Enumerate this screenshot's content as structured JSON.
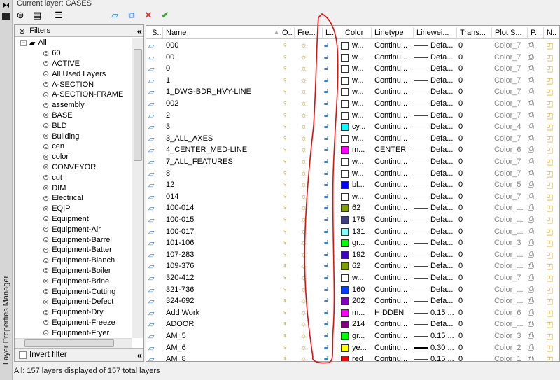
{
  "window": {
    "title": "Current layer: CASES",
    "panel_title": "Layer Properties Manager"
  },
  "toolbar": [
    "new-property-filter",
    "new-group-filter",
    "layer-states-manager",
    "new-layer",
    "new-layer-vp-frozen",
    "delete-layer",
    "set-current"
  ],
  "filters": {
    "title": "Filters",
    "invert_label": "Invert filter",
    "root": "All",
    "items": [
      "60",
      "ACTIVE",
      "All Used Layers",
      "A-SECTION",
      "A-SECTION-FRAME",
      "assembly",
      "BASE",
      "BLD",
      "Building",
      "cen",
      "color",
      "CONVEYOR",
      "cut",
      "DIM",
      "Electrical",
      "EQIP",
      "Equipment",
      "Equipment-Air",
      "Equipment-Barrel",
      "Equipment-Batter",
      "Equipment-Blanch",
      "Equipment-Boiler",
      "Equipment-Brine",
      "Equipment-Cutting",
      "Equipment-Defect",
      "Equipment-Dry",
      "Equipment-Freeze",
      "Equipment-Fryer"
    ]
  },
  "columns": [
    "S..",
    "Name",
    "O..",
    "Fre...",
    "L...",
    "Color",
    "Linetype",
    "Linewei...",
    "Trans...",
    "Plot S...",
    "P...",
    "N.."
  ],
  "layers": [
    {
      "name": "000",
      "color": "w...",
      "hex": "#ffffff",
      "linetype": "Continu...",
      "lineweight": "Defa...",
      "trans": "0",
      "plot": "Color_7"
    },
    {
      "name": "00",
      "color": "w...",
      "hex": "#ffffff",
      "linetype": "Continu...",
      "lineweight": "Defa...",
      "trans": "0",
      "plot": "Color_7"
    },
    {
      "name": "0",
      "color": "w...",
      "hex": "#ffffff",
      "linetype": "Continu...",
      "lineweight": "Defa...",
      "trans": "0",
      "plot": "Color_7"
    },
    {
      "name": "1",
      "color": "w...",
      "hex": "#ffffff",
      "linetype": "Continu...",
      "lineweight": "Defa...",
      "trans": "0",
      "plot": "Color_7"
    },
    {
      "name": "1_DWG-BDR_HVY-LINE",
      "color": "w...",
      "hex": "#ffffff",
      "linetype": "Continu...",
      "lineweight": "Defa...",
      "trans": "0",
      "plot": "Color_7"
    },
    {
      "name": "002",
      "color": "w...",
      "hex": "#ffffff",
      "linetype": "Continu...",
      "lineweight": "Defa...",
      "trans": "0",
      "plot": "Color_7"
    },
    {
      "name": "2",
      "color": "w...",
      "hex": "#ffffff",
      "linetype": "Continu...",
      "lineweight": "Defa...",
      "trans": "0",
      "plot": "Color_7"
    },
    {
      "name": "3",
      "color": "cy...",
      "hex": "#00ffff",
      "linetype": "Continu...",
      "lineweight": "Defa...",
      "trans": "0",
      "plot": "Color_4"
    },
    {
      "name": "3_ALL_AXES",
      "color": "w...",
      "hex": "#ffffff",
      "linetype": "Continu...",
      "lineweight": "Defa...",
      "trans": "0",
      "plot": "Color_7"
    },
    {
      "name": "4_CENTER_MED-LINE",
      "color": "m...",
      "hex": "#ff00ff",
      "linetype": "CENTER",
      "lineweight": "Defa...",
      "trans": "0",
      "plot": "Color_6"
    },
    {
      "name": "7_ALL_FEATURES",
      "color": "w...",
      "hex": "#ffffff",
      "linetype": "Continu...",
      "lineweight": "Defa...",
      "trans": "0",
      "plot": "Color_7"
    },
    {
      "name": "8",
      "color": "w...",
      "hex": "#ffffff",
      "linetype": "Continu...",
      "lineweight": "Defa...",
      "trans": "0",
      "plot": "Color_7"
    },
    {
      "name": "12",
      "color": "bl...",
      "hex": "#0000ff",
      "linetype": "Continu...",
      "lineweight": "Defa...",
      "trans": "0",
      "plot": "Color_5"
    },
    {
      "name": "014",
      "color": "w...",
      "hex": "#ffffff",
      "linetype": "Continu...",
      "lineweight": "Defa...",
      "trans": "0",
      "plot": "Color_7"
    },
    {
      "name": "100-014",
      "color": "62",
      "hex": "#7f9f00",
      "linetype": "Continu...",
      "lineweight": "Defa...",
      "trans": "0",
      "plot": "Color_..."
    },
    {
      "name": "100-015",
      "color": "175",
      "hex": "#3f3f7f",
      "linetype": "Continu...",
      "lineweight": "Defa...",
      "trans": "0",
      "plot": "Color_..."
    },
    {
      "name": "100-017",
      "color": "131",
      "hex": "#7fffff",
      "linetype": "Continu...",
      "lineweight": "Defa...",
      "trans": "0",
      "plot": "Color_..."
    },
    {
      "name": "101-106",
      "color": "gr...",
      "hex": "#00ff00",
      "linetype": "Continu...",
      "lineweight": "Defa...",
      "trans": "0",
      "plot": "Color_3"
    },
    {
      "name": "107-283",
      "color": "192",
      "hex": "#3f00bf",
      "linetype": "Continu...",
      "lineweight": "Defa...",
      "trans": "0",
      "plot": "Color_..."
    },
    {
      "name": "109-376",
      "color": "62",
      "hex": "#7f9f00",
      "linetype": "Continu...",
      "lineweight": "Defa...",
      "trans": "0",
      "plot": "Color_..."
    },
    {
      "name": "320-412",
      "color": "w...",
      "hex": "#ffffff",
      "linetype": "Continu...",
      "lineweight": "Defa...",
      "trans": "0",
      "plot": "Color_7"
    },
    {
      "name": "321-736",
      "color": "160",
      "hex": "#003fff",
      "linetype": "Continu...",
      "lineweight": "Defa...",
      "trans": "0",
      "plot": "Color_..."
    },
    {
      "name": "324-692",
      "color": "202",
      "hex": "#7f00bf",
      "linetype": "Continu...",
      "lineweight": "Defa...",
      "trans": "0",
      "plot": "Color_..."
    },
    {
      "name": "Add Work",
      "color": "m...",
      "hex": "#ff00ff",
      "linetype": "HIDDEN",
      "lineweight": "0.15 ...",
      "trans": "0",
      "plot": "Color_6"
    },
    {
      "name": "ADOOR",
      "color": "214",
      "hex": "#7f007f",
      "linetype": "Continu...",
      "lineweight": "Defa...",
      "trans": "0",
      "plot": "Color_..."
    },
    {
      "name": "AM_5",
      "color": "gr...",
      "hex": "#00ff00",
      "linetype": "Continu...",
      "lineweight": "0.15 ...",
      "trans": "0",
      "plot": "Color_3"
    },
    {
      "name": "AM_6",
      "color": "ye...",
      "hex": "#ffff00",
      "linetype": "Continu...",
      "lineweight": "0.30 ...",
      "trans": "0",
      "plot": "Color_2",
      "heavy": true
    },
    {
      "name": "AM_8",
      "color": "red",
      "hex": "#ff0000",
      "linetype": "Continu...",
      "lineweight": "0.15 ...",
      "trans": "0",
      "plot": "Color_1"
    }
  ],
  "status": "All: 157 layers displayed of 157 total layers"
}
